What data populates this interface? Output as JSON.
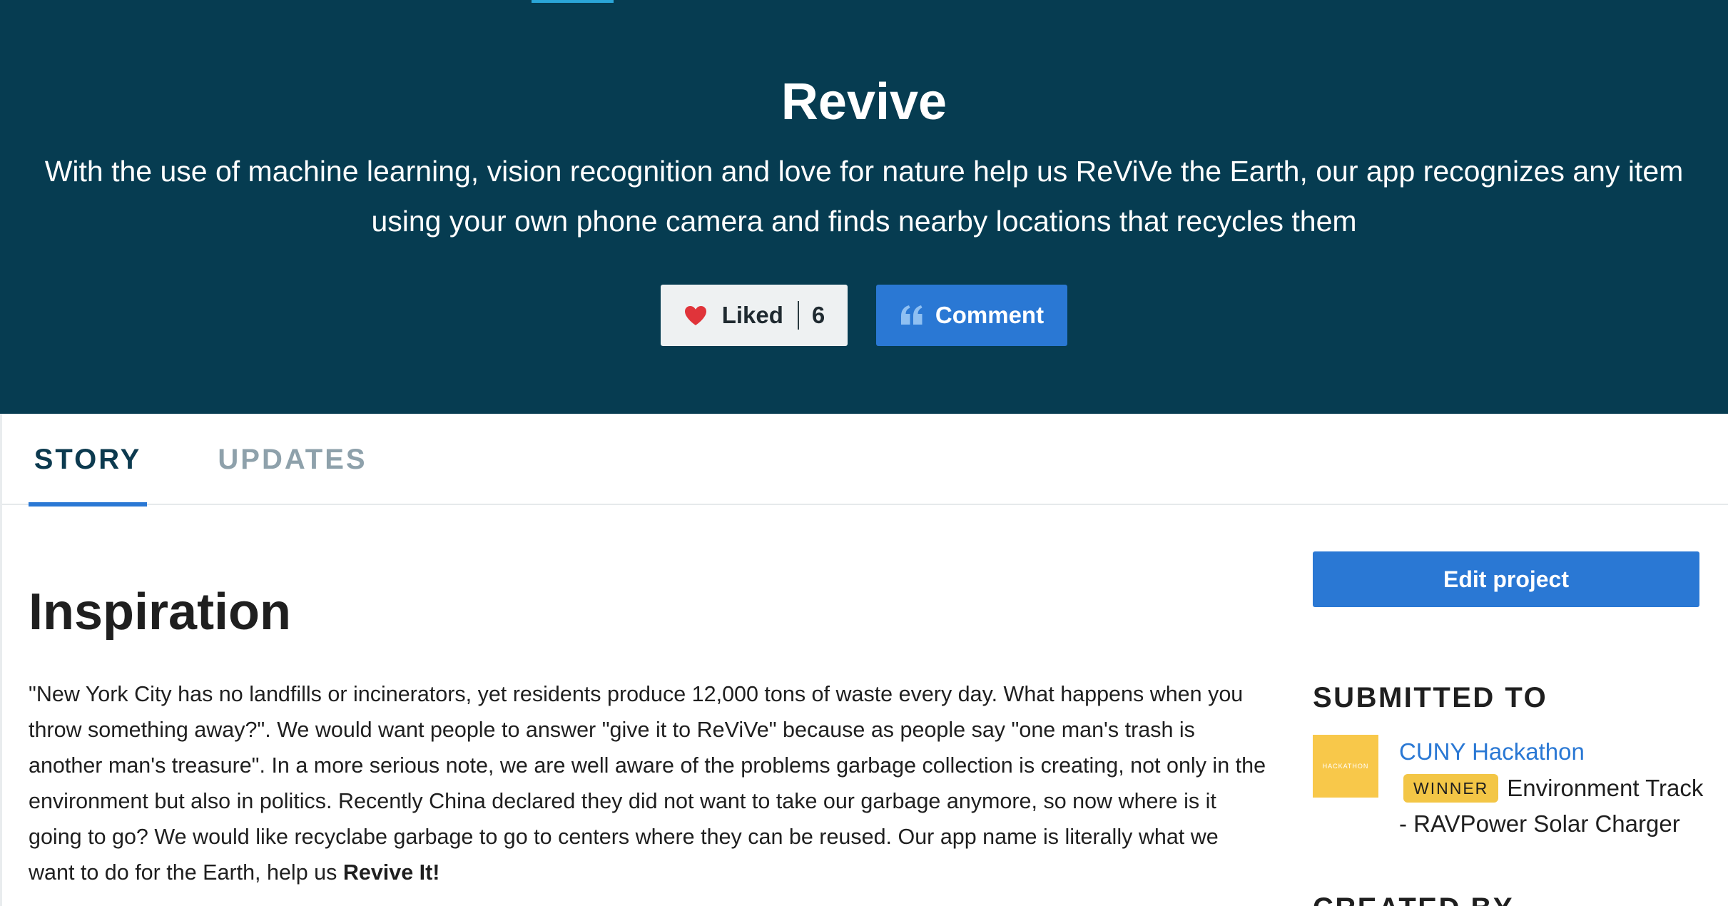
{
  "hero": {
    "title": "Revive",
    "tagline": "With the use of machine learning, vision recognition and love for nature help us ReViVe the Earth, our app recognizes any item using your own phone camera and finds nearby locations that recycles them",
    "like_label": "Liked",
    "like_count": "6",
    "comment_label": "Comment",
    "icons": {
      "like": "heart-icon",
      "comment": "quote-icon"
    }
  },
  "tabs": [
    {
      "label": "STORY",
      "active": true
    },
    {
      "label": "UPDATES",
      "active": false
    }
  ],
  "story": {
    "heading": "Inspiration",
    "paragraph": "\"New York City has no landfills or incinerators, yet residents produce 12,000 tons of waste every day. What happens when you throw something away?\". We would want people to answer \"give it to ReViVe\" because as people say \"one man's trash is another man's treasure\". In a more serious note, we are well aware of the problems garbage collection is creating, not only in the environment but also in politics. Recently China declared they did not want to take our garbage anymore, so now where is it going to go? We would like recyclabe garbage to go to centers where they can be reused. Our app name is literally what we want to do for the Earth, help us ",
    "paragraph_bold_end": "Revive It!"
  },
  "sidebar": {
    "edit_label": "Edit project",
    "submitted_heading": "SUBMITTED TO",
    "hackathon": {
      "logo_text": "HACKATHON",
      "name": "CUNY Hackathon",
      "badge": "WINNER",
      "prize": "Environment Track - RAVPower Solar Charger"
    },
    "created_heading": "CREATED BY"
  },
  "colors": {
    "hero_bg": "#063c51",
    "accent_blue": "#2a78d4",
    "winner_yellow": "#f3c646",
    "heart_red": "#e0343a"
  }
}
